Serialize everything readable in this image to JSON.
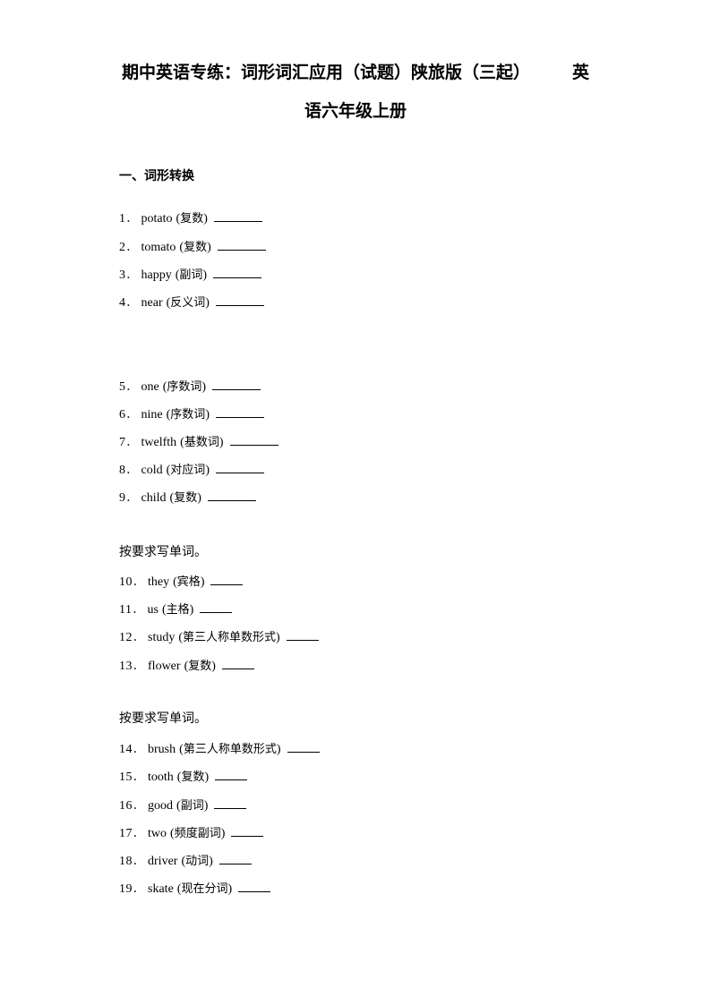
{
  "document": {
    "title_line_1_parts": [
      "期中英语专练：词形词汇应用（试题）陕旅版（三起）",
      "英"
    ],
    "title_line_2": "语六年级上册",
    "sections": [
      {
        "heading": "一、词形转换",
        "items": [
          {
            "num": "1",
            "word": "potato",
            "hint": "复数"
          },
          {
            "num": "2",
            "word": "tomato",
            "hint": "复数"
          },
          {
            "num": "3",
            "word": "happy",
            "hint": "副词"
          },
          {
            "num": "4",
            "word": "near",
            "hint": "反义词"
          },
          {
            "num": "5",
            "word": "one",
            "hint": "序数词"
          },
          {
            "num": "6",
            "word": "nine",
            "hint": "序数词"
          },
          {
            "num": "7",
            "word": "twelfth",
            "hint": "基数词"
          },
          {
            "num": "8",
            "word": "cold",
            "hint": "对应词"
          },
          {
            "num": "9",
            "word": "child",
            "hint": "复数"
          }
        ]
      },
      {
        "instruction": "按要求写单词。",
        "items": [
          {
            "num": "10",
            "word": "they",
            "hint": "宾格"
          },
          {
            "num": "11",
            "word": "us",
            "hint": "主格"
          },
          {
            "num": "12",
            "word": "study",
            "hint": "第三人称单数形式"
          },
          {
            "num": "13",
            "word": "flower",
            "hint": "复数"
          }
        ]
      },
      {
        "instruction": "按要求写单词。",
        "items": [
          {
            "num": "14",
            "word": "brush",
            "hint": "第三人称单数形式"
          },
          {
            "num": "15",
            "word": "tooth",
            "hint": "复数"
          },
          {
            "num": "16",
            "word": "good",
            "hint": "副词"
          },
          {
            "num": "17",
            "word": "two",
            "hint": "频度副词"
          },
          {
            "num": "18",
            "word": "driver",
            "hint": "动词"
          },
          {
            "num": "19",
            "word": "skate",
            "hint": "现在分词"
          }
        ]
      }
    ],
    "punct": {
      "dot": "．",
      "open": "(",
      "close": ")"
    }
  }
}
